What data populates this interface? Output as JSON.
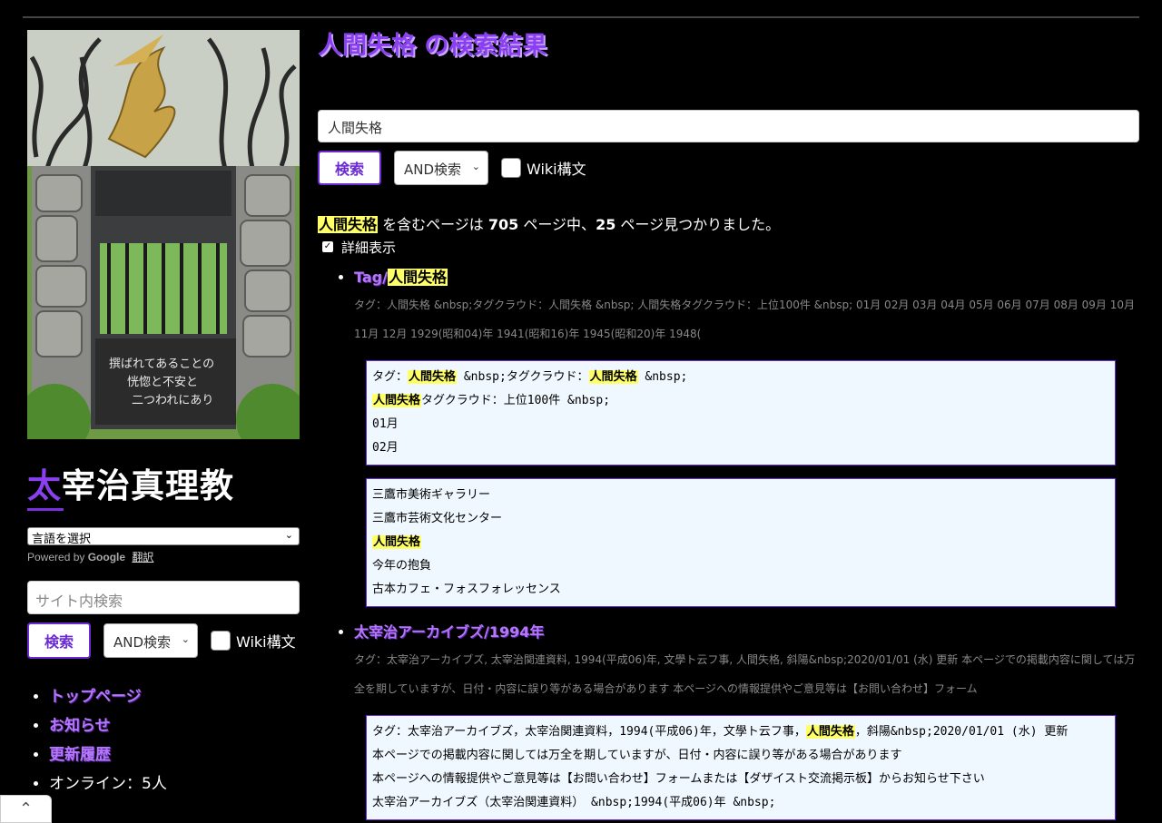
{
  "sidebar": {
    "site_title_first": "太",
    "site_title_rest": "宰治真理教",
    "lang_select": "言語を選択",
    "powered_by": "Powered by",
    "google": "Google",
    "translate": "翻訳",
    "search_placeholder": "サイト内検索",
    "search_button": "検索",
    "mode": "AND検索",
    "wiki_label": "Wiki構文",
    "nav": [
      {
        "label": "トップページ",
        "link": true
      },
      {
        "label": "お知らせ",
        "link": true
      },
      {
        "label": "更新履歴",
        "link": true
      },
      {
        "label": "オンライン：5人",
        "link": false
      }
    ],
    "photo_inscription": [
      "撰ばれてあることの",
      "恍惚と不安と",
      "二つわれにあり"
    ]
  },
  "main": {
    "title": "人間失格 の検索結果",
    "search_value": "人間失格",
    "search_button": "検索",
    "mode": "AND検索",
    "wiki_label": "Wiki構文",
    "summary": {
      "term": "人間失格",
      "text1": " を含むページは ",
      "total": "705",
      "text2": " ページ中、",
      "found": "25",
      "text3": " ページ見つかりました。"
    },
    "detail_label": "詳細表示",
    "results": [
      {
        "title_prefix": "Tag/",
        "title_highlight": "人間失格",
        "title_suffix": "",
        "snippet": "タグ：人間失格 &nbsp;タグクラウド：人間失格 &nbsp; 人間失格タグクラウド：上位100件 &nbsp; 01月 02月 03月 04月 05月 06月 07月 08月 09月 10月 11月 12月 1929(昭和04)年 1941(昭和16)年 1945(昭和20)年 1948(",
        "box1": [
          [
            "タグ：",
            "人間失格",
            " &nbsp;タグクラウド：",
            "人間失格",
            " &nbsp;"
          ],
          [
            "",
            "人間失格",
            "タグクラウド：上位100件 &nbsp;",
            "",
            ""
          ],
          [
            "01月",
            "",
            "",
            "",
            ""
          ],
          [
            "02月",
            "",
            "",
            "",
            ""
          ]
        ],
        "box2": [
          [
            "三鷹市美術ギャラリー",
            ""
          ],
          [
            "三鷹市芸術文化センター",
            ""
          ],
          [
            "",
            "人間失格"
          ],
          [
            "今年の抱負",
            ""
          ],
          [
            "古本カフェ・フォスフォレッセンス",
            ""
          ]
        ]
      },
      {
        "title_prefix": "太宰治アーカイブズ/1994年",
        "snippet": "タグ：太宰治アーカイブズ, 太宰治関連資料, 1994(平成06)年, 文學ト云フ事, 人間失格, 斜陽&nbsp;2020/01/01 (水) 更新 本ページでの掲載内容に関しては万全を期していますが、日付・内容に誤り等がある場合があります 本ページへの情報提供やご意見等は【お問い合わせ】フォーム",
        "box1_line1_a": "タグ：太宰治アーカイブズ，太宰治関連資料，1994(平成06)年，文學ト云フ事，",
        "box1_line1_hl": "人間失格",
        "box1_line1_b": "，斜陽&nbsp;2020/01/01 (水) 更新",
        "box1_lines": [
          "本ページでの掲載内容に関しては万全を期していますが、日付・内容に誤り等がある場合があります",
          "本ページへの情報提供やご意見等は【お問い合わせ】フォームまたは【ダザイスト交流掲示板】からお知らせ下さい",
          "太宰治アーカイブズ（太宰治関連資料） &nbsp;1994(平成06)年 &nbsp;"
        ]
      }
    ]
  }
}
